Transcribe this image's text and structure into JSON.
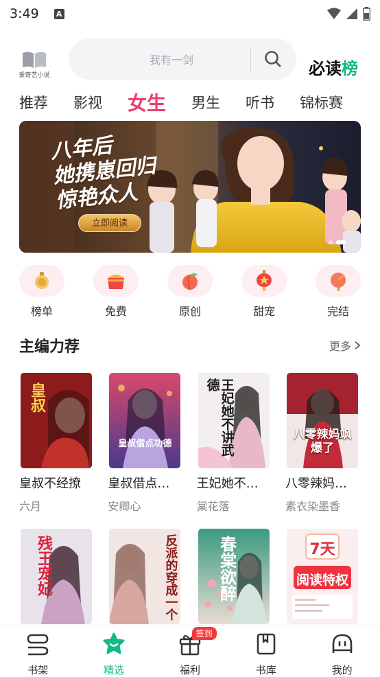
{
  "status_bar": {
    "time": "3:49",
    "notification_letter": "A",
    "icons": [
      "wifi-icon",
      "signal-icon",
      "battery-icon"
    ]
  },
  "header": {
    "logo_text": "爱奇艺小说",
    "search_placeholder": "我有一剑",
    "rank_badge_black": "必读",
    "rank_badge_green": "榜"
  },
  "tabs": [
    {
      "label": "推荐"
    },
    {
      "label": "影视"
    },
    {
      "label": "女生",
      "active": true
    },
    {
      "label": "男生"
    },
    {
      "label": "听书"
    },
    {
      "label": "锦标赛"
    }
  ],
  "banner": {
    "title_line1": "八年后",
    "title_line2": "她携崽回归",
    "title_line3": "惊艳众人",
    "button_label": "立即阅读",
    "slide_index": 2,
    "slide_count": 2
  },
  "categories": [
    {
      "label": "榜单",
      "icon": "trophy-icon"
    },
    {
      "label": "免费",
      "icon": "gift-bag-icon"
    },
    {
      "label": "原创",
      "icon": "peach-icon"
    },
    {
      "label": "甜宠",
      "icon": "lantern-icon"
    },
    {
      "label": "完结",
      "icon": "fan-icon"
    }
  ],
  "section": {
    "title": "主编力荐",
    "more_label": "更多"
  },
  "books_row1": [
    {
      "title": "皇叔不经撩",
      "author": "六月",
      "cover_text": "皇叔",
      "cover_color": "#8e1b1b"
    },
    {
      "title": "皇叔借点…",
      "author": "安卿心",
      "cover_text": "皇叔借点功德",
      "cover_color": "#6a4c9c"
    },
    {
      "title": "王妃她不…",
      "author": "棠花落",
      "cover_text": "王妃她不讲武德",
      "cover_color": "#f3eef0"
    },
    {
      "title": "八零辣妈…",
      "author": "素衣染墨香",
      "cover_text": "八零辣妈飒爆了",
      "cover_color": "#8a1c26"
    }
  ],
  "books_row2": [
    {
      "cover_text": "残王宠妃",
      "cover_color": "#e8e2ea"
    },
    {
      "cover_text": "反派的穿成一个",
      "cover_color": "#f1e6e2"
    },
    {
      "cover_text": "春棠欲醉",
      "cover_color": "#2f8a76"
    },
    {
      "cover_text_top": "7天",
      "cover_text_bottom": "阅读特权",
      "cover_color": "#fbe7e7"
    }
  ],
  "bottom_nav": [
    {
      "label": "书架",
      "icon": "bookshelf-icon"
    },
    {
      "label": "精选",
      "icon": "featured-star-icon",
      "active": true
    },
    {
      "label": "福利",
      "icon": "gift-box-icon",
      "badge": "签到"
    },
    {
      "label": "书库",
      "icon": "library-icon"
    },
    {
      "label": "我的",
      "icon": "profile-icon"
    }
  ],
  "colors": {
    "accent_pink": "#ed3d6f",
    "accent_green": "#13b886",
    "badge_red": "#ef3b3b"
  }
}
